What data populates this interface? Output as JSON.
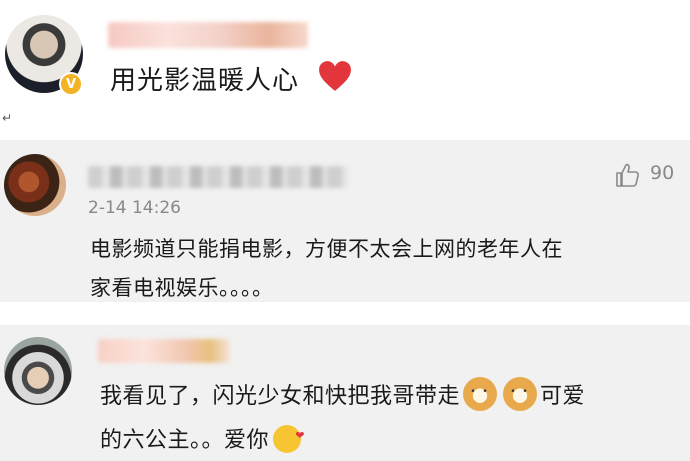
{
  "post": {
    "text": "用光影温暖人心",
    "return_mark": "↵"
  },
  "comment1": {
    "time": "2-14 14:26",
    "likes": "90",
    "text_line1": "电影频道只能捐电影，方便不太会上网的老年人在",
    "text_line2": "家看电视娱乐。。。。"
  },
  "comment2": {
    "text_part1": "我看见了，闪光少女和快把我哥带走",
    "text_part2": "可爱",
    "text_line2": "的六公主。。爱你"
  },
  "icons": {
    "verified": "verified-badge-icon",
    "heart": "red-heart-icon",
    "like": "thumbs-up-icon",
    "doge": "doge-emoji",
    "kiss": "kiss-emoji"
  },
  "colors": {
    "verified_badge": "#f3b324",
    "heart": "#e2353c",
    "comment_bg": "#f1f1f1",
    "meta_text": "#888888"
  }
}
